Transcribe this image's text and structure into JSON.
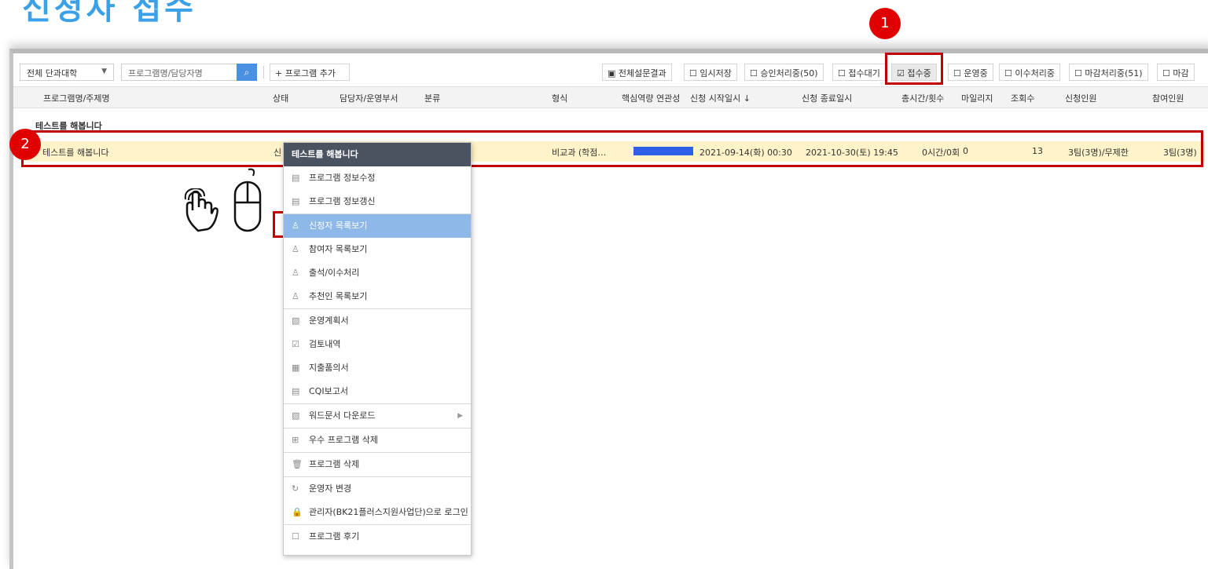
{
  "page_title": "신청자 접수",
  "toolbar": {
    "college_select": "전체 단과대학",
    "search_placeholder": "프로그램명/담당자명",
    "add_program": "+ 프로그램 추가",
    "survey_results": "전체설문결과",
    "filters": [
      "임시저장",
      "승인처리중(50)",
      "접수대기",
      "접수중",
      "운영중",
      "이수처리중",
      "마감처리중(51)",
      "마감"
    ],
    "active_filter": "접수중"
  },
  "table": {
    "headers": [
      "프로그램명/주제명",
      "상태",
      "담당자/운영부서",
      "분류",
      "형식",
      "핵심역량 연관성",
      "신청 시작일시 ↓",
      "신청 종료일시",
      "총시간/횟수",
      "마일리지",
      "조회수",
      "신청인원",
      "참여인원"
    ],
    "group": "테스트를 해봅니다",
    "row": {
      "name": "테스트를 해봅니다",
      "status": "신",
      "type": "비교과 (학점…",
      "start": "2021-09-14(화) 00:30",
      "end": "2021-10-30(토) 19:45",
      "hours": "0시간/0회",
      "mileage": "0",
      "views": "13",
      "applicants": "3팀(3명)/무제한",
      "participants": "3팀(3명)",
      "competency_level": 1.0
    }
  },
  "context_menu": {
    "header": "테스트를 해봅니다",
    "items": [
      {
        "label": "프로그램 정보수정",
        "icon": "document-icon"
      },
      {
        "label": "프로그램 정보갱신",
        "icon": "document-icon"
      },
      {
        "label": "신청자 목록보기",
        "icon": "users-icon",
        "selected": true
      },
      {
        "label": "참여자 목록보기",
        "icon": "user-icon"
      },
      {
        "label": "출석/이수처리",
        "icon": "user-icon"
      },
      {
        "label": "추천인 목록보기",
        "icon": "user-icon"
      },
      {
        "label": "운영계획서",
        "icon": "doc-w-icon"
      },
      {
        "label": "검토내역",
        "icon": "check-doc-icon"
      },
      {
        "label": "지출품의서",
        "icon": "grid-doc-icon"
      },
      {
        "label": "CQI보고서",
        "icon": "doc-lines-icon"
      },
      {
        "label": "워드문서 다운로드",
        "icon": "doc-w-icon"
      },
      {
        "label": "우수 프로그램 삭제",
        "icon": "plus-doc-icon"
      },
      {
        "label": "프로그램 삭제",
        "icon": "trash-icon"
      },
      {
        "label": "운영자 변경",
        "icon": "refresh-icon"
      },
      {
        "label": "관리자(BK21플러스지원사업단)으로 로그인",
        "icon": "lock-icon"
      },
      {
        "label": "프로그램 후기",
        "icon": "square-icon"
      }
    ]
  },
  "annotations": {
    "step1": "1",
    "step2": "2"
  },
  "colors": {
    "highlight": "#c00000",
    "accent": "#4a90e2",
    "row_bg": "#fff3c9",
    "callout": "#dde8cd"
  }
}
